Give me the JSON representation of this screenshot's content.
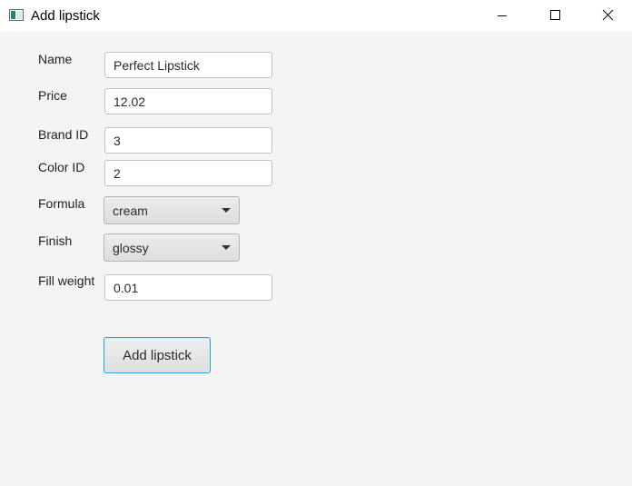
{
  "window": {
    "title": "Add lipstick",
    "icon": "app-window-icon"
  },
  "window_controls": {
    "minimize_icon": "minimize-icon",
    "maximize_icon": "maximize-icon",
    "close_icon": "close-icon"
  },
  "form": {
    "name": {
      "label": "Name",
      "value": "Perfect Lipstick"
    },
    "price": {
      "label": "Price",
      "value": "12.02"
    },
    "brand_id": {
      "label": "Brand ID",
      "value": "3"
    },
    "color_id": {
      "label": "Color ID",
      "value": "2"
    },
    "formula": {
      "label": "Formula",
      "selected": "cream"
    },
    "finish": {
      "label": "Finish",
      "selected": "glossy"
    },
    "fill_weight": {
      "label": "Fill weight",
      "value": "0.01"
    },
    "submit_label": "Add lipstick"
  },
  "colors": {
    "accent": "#2a9fd6",
    "background": "#f4f4f4",
    "titlebar": "#ffffff"
  }
}
